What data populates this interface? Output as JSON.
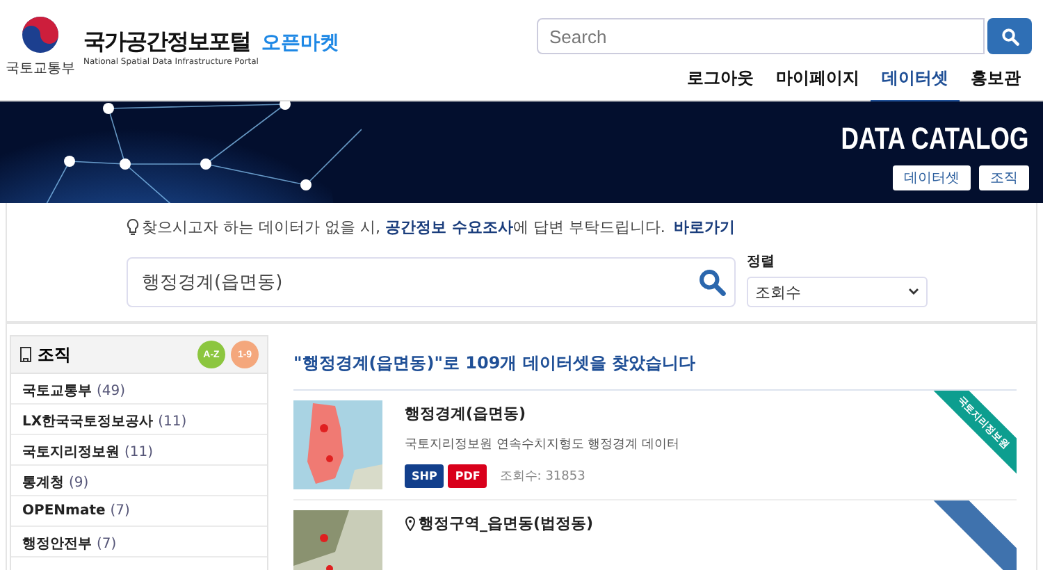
{
  "header": {
    "ministry": "국토교통부",
    "portal_title": "국가공간정보포털",
    "portal_badge": "오픈마켓",
    "portal_subtitle": "National Spatial Data Infrastructure Portal",
    "search": {
      "placeholder": "Search"
    },
    "nav": [
      {
        "label": "로그아웃",
        "selected": false
      },
      {
        "label": "마이페이지",
        "selected": false
      },
      {
        "label": "데이터셋",
        "selected": true
      },
      {
        "label": "홍보관",
        "selected": false
      }
    ]
  },
  "banner": {
    "title": "DATA CATALOG",
    "buttons": [
      "데이터셋",
      "조직"
    ]
  },
  "notice": {
    "text": "찾으시고자 하는 데이터가 없을 시, **공간정보 수요조사**에 답변 부탁드립니다.",
    "link": "바로가기"
  },
  "search": {
    "value": "행정경계(읍면동)"
  },
  "sort": {
    "label": "정렬",
    "value": "조회수"
  },
  "sidebar": {
    "title": "조직",
    "sort_buttons": [
      {
        "label": "A-Z",
        "color": "#8cc63f"
      },
      {
        "label": "1-9",
        "color": "#f4a77c"
      }
    ],
    "items": [
      {
        "name": "국토교통부",
        "count": "(49)"
      },
      {
        "name": "LX한국국토정보공사",
        "count": "(11)"
      },
      {
        "name": "국토지리정보원",
        "count": "(11)"
      },
      {
        "name": "통계청",
        "count": "(9)"
      },
      {
        "name": "OPENmate",
        "count": "(7)"
      },
      {
        "name": "행정안전부",
        "count": "(7)"
      }
    ]
  },
  "results": {
    "summary": "\"행정경계(읍면동)\"로 109개 데이터셋을 찾았습니다",
    "items": [
      {
        "title": "행정경계(읍면동)",
        "pin": false,
        "description": "국토지리정보원 연속수치지형도 행정경계 데이터",
        "formats": [
          {
            "label": "SHP",
            "color": "#123f8c"
          },
          {
            "label": "PDF",
            "color": "#d9001b"
          }
        ],
        "views": "조회수: 31853",
        "ribbon": {
          "label": "국토지리정보원",
          "color": "#0d9e8f"
        }
      },
      {
        "title": "행정구역_읍면동(법정동)",
        "pin": true,
        "ribbon": {
          "color": "#3f72ad"
        }
      }
    ]
  }
}
